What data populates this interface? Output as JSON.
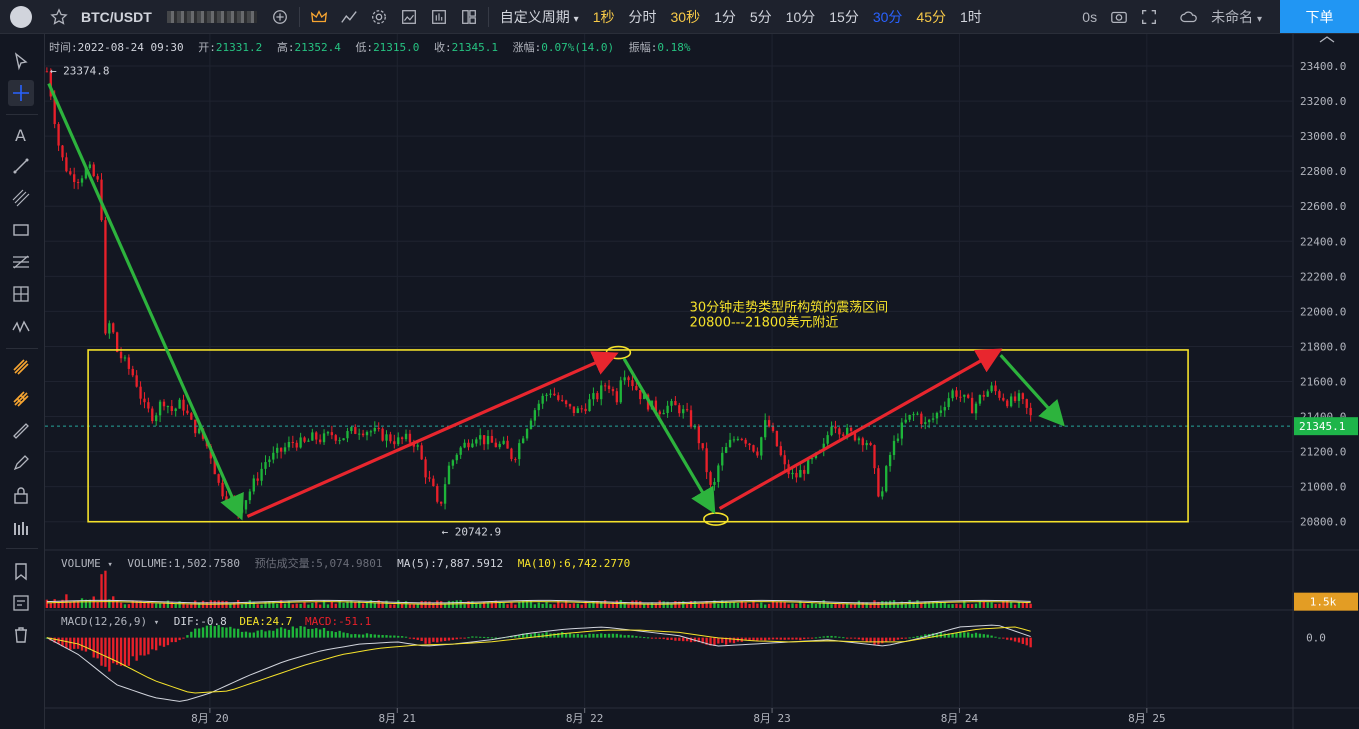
{
  "toolbar": {
    "symbol": "BTC/USDT",
    "custom_period_label": "自定义周期",
    "timeframes": [
      {
        "label": "1秒",
        "state": "fav"
      },
      {
        "label": "分时",
        "state": ""
      },
      {
        "label": "30秒",
        "state": "fav"
      },
      {
        "label": "1分",
        "state": ""
      },
      {
        "label": "5分",
        "state": ""
      },
      {
        "label": "10分",
        "state": ""
      },
      {
        "label": "15分",
        "state": ""
      },
      {
        "label": "30分",
        "state": "active"
      },
      {
        "label": "45分",
        "state": "fav"
      },
      {
        "label": "1时",
        "state": ""
      }
    ],
    "replay_label": "0s",
    "layout_name": "未命名",
    "order_button": "下单"
  },
  "header": {
    "time_label": "时间:",
    "time": "2022-08-24 09:30",
    "open_label": "开:",
    "open": "21331.2",
    "high_label": "高:",
    "high": "21352.4",
    "low_label": "低:",
    "low": "21315.0",
    "close_label": "收:",
    "close": "21345.1",
    "change_label": "涨幅:",
    "change": "0.07%(14.0)",
    "amplitude_label": "振幅:",
    "amplitude": "0.18%"
  },
  "volume_legend": {
    "name": "VOLUME",
    "volume": "VOLUME:1,502.7580",
    "estimated": "预估成交量:5,074.9801",
    "ma5": "MA(5):7,887.5912",
    "ma10": "MA(10):6,742.2770"
  },
  "macd_legend": {
    "name": "MACD(12,26,9)",
    "dif": "DIF:-0.8",
    "dea": "DEA:24.7",
    "macd": "MACD:-51.1"
  },
  "colors": {
    "background": "#131722",
    "up": "#26a69a",
    "up_bright": "#1eb53a",
    "down": "#e8202a",
    "box": "#f5e22b",
    "annotation": "#f5e22b",
    "arrow_green": "#2db33d",
    "arrow_red": "#e8262e",
    "price_badge": "#1eb54a",
    "vol_badge": "#e39d24"
  },
  "chart_data": {
    "type": "candlestick",
    "symbol": "BTC/USDT",
    "interval": "30分",
    "ylim": [
      20650,
      23480
    ],
    "yticks": [
      23400,
      23200,
      23000,
      22800,
      22600,
      22400,
      22200,
      22000,
      21800,
      21600,
      21400,
      21200,
      21000,
      20800
    ],
    "ytick_labels": [
      "23400.0",
      "23200.0",
      "23000.0",
      "22800.0",
      "22600.0",
      "22400.0",
      "22200.0",
      "22000.0",
      "21800.0",
      "21600.0",
      "21400.0",
      "21200.0",
      "21000.0",
      "20800.0"
    ],
    "xticks": [
      "8月 20",
      "8月 21",
      "8月 22",
      "8月 23",
      "8月 24",
      "8月 25"
    ],
    "x_range_days": [
      19.12,
      25.78
    ],
    "xtick_days": [
      20,
      21,
      22,
      23,
      24,
      25
    ],
    "last_price": 21345.1,
    "last_price_label": "21345.1",
    "high_marker": {
      "day": 19.13,
      "price": 23374.8,
      "label": "23374.8"
    },
    "low_marker": {
      "day": 21.22,
      "price": 20742.9,
      "label": "20742.9"
    },
    "range_box": {
      "day_start": 19.35,
      "day_end": 25.22,
      "price_low": 20800,
      "price_high": 21780
    },
    "annotation": [
      "30分钟走势类型所构筑的震荡区间",
      "20800---21800美元附近"
    ],
    "annotation_anchor": {
      "day": 22.56,
      "price": 22000
    },
    "circles": [
      {
        "day": 22.18,
        "price": 21765
      },
      {
        "day": 22.7,
        "price": 20815
      }
    ],
    "arrows": [
      {
        "from": [
          19.14,
          23300
        ],
        "to": [
          20.16,
          20840
        ],
        "color": "green"
      },
      {
        "from": [
          20.2,
          20830
        ],
        "to": [
          22.15,
          21750
        ],
        "color": "red"
      },
      {
        "from": [
          22.21,
          21730
        ],
        "to": [
          22.68,
          20875
        ],
        "color": "green"
      },
      {
        "from": [
          22.72,
          20875
        ],
        "to": [
          24.2,
          21770
        ],
        "color": "red"
      },
      {
        "from": [
          24.22,
          21750
        ],
        "to": [
          24.54,
          21370
        ],
        "color": "green"
      }
    ],
    "price_path": [
      [
        19.13,
        23370
      ],
      [
        19.15,
        23250
      ],
      [
        19.2,
        22900
      ],
      [
        19.25,
        22780
      ],
      [
        19.3,
        22760
      ],
      [
        19.35,
        22820
      ],
      [
        19.42,
        22700
      ],
      [
        19.43,
        21800
      ],
      [
        19.47,
        21950
      ],
      [
        19.5,
        21780
      ],
      [
        19.55,
        21700
      ],
      [
        19.6,
        21620
      ],
      [
        19.65,
        21450
      ],
      [
        19.7,
        21400
      ],
      [
        19.75,
        21500
      ],
      [
        19.8,
        21430
      ],
      [
        19.85,
        21480
      ],
      [
        19.9,
        21360
      ],
      [
        19.95,
        21300
      ],
      [
        20.0,
        21200
      ],
      [
        20.05,
        21000
      ],
      [
        20.1,
        20920
      ],
      [
        20.15,
        20860
      ],
      [
        20.2,
        20950
      ],
      [
        20.25,
        21050
      ],
      [
        20.3,
        21150
      ],
      [
        20.35,
        21180
      ],
      [
        20.4,
        21220
      ],
      [
        20.45,
        21260
      ],
      [
        20.5,
        21240
      ],
      [
        20.55,
        21280
      ],
      [
        20.6,
        21270
      ],
      [
        20.65,
        21300
      ],
      [
        20.7,
        21280
      ],
      [
        20.75,
        21310
      ],
      [
        20.8,
        21330
      ],
      [
        20.85,
        21320
      ],
      [
        20.9,
        21300
      ],
      [
        20.95,
        21280
      ],
      [
        21.0,
        21260
      ],
      [
        21.05,
        21270
      ],
      [
        21.1,
        21250
      ],
      [
        21.15,
        21080
      ],
      [
        21.2,
        20960
      ],
      [
        21.22,
        20850
      ],
      [
        21.27,
        21100
      ],
      [
        21.32,
        21200
      ],
      [
        21.37,
        21250
      ],
      [
        21.42,
        21300
      ],
      [
        21.47,
        21260
      ],
      [
        21.52,
        21240
      ],
      [
        21.57,
        21230
      ],
      [
        21.62,
        21160
      ],
      [
        21.67,
        21300
      ],
      [
        21.72,
        21420
      ],
      [
        21.77,
        21500
      ],
      [
        21.82,
        21550
      ],
      [
        21.87,
        21480
      ],
      [
        21.92,
        21440
      ],
      [
        21.97,
        21430
      ],
      [
        22.02,
        21480
      ],
      [
        22.07,
        21520
      ],
      [
        22.12,
        21600
      ],
      [
        22.17,
        21500
      ],
      [
        22.2,
        21680
      ],
      [
        22.25,
        21600
      ],
      [
        22.3,
        21520
      ],
      [
        22.35,
        21460
      ],
      [
        22.4,
        21440
      ],
      [
        22.45,
        21460
      ],
      [
        22.5,
        21450
      ],
      [
        22.55,
        21400
      ],
      [
        22.6,
        21300
      ],
      [
        22.64,
        21150
      ],
      [
        22.68,
        20950
      ],
      [
        22.72,
        21150
      ],
      [
        22.77,
        21240
      ],
      [
        22.82,
        21300
      ],
      [
        22.87,
        21260
      ],
      [
        22.92,
        21200
      ],
      [
        22.97,
        21380
      ],
      [
        23.02,
        21250
      ],
      [
        23.07,
        21100
      ],
      [
        23.12,
        21050
      ],
      [
        23.17,
        21100
      ],
      [
        23.22,
        21150
      ],
      [
        23.27,
        21200
      ],
      [
        23.32,
        21380
      ],
      [
        23.37,
        21320
      ],
      [
        23.42,
        21300
      ],
      [
        23.47,
        21280
      ],
      [
        23.52,
        21250
      ],
      [
        23.55,
        21050
      ],
      [
        23.58,
        20920
      ],
      [
        23.62,
        21150
      ],
      [
        23.67,
        21300
      ],
      [
        23.72,
        21380
      ],
      [
        23.77,
        21420
      ],
      [
        23.82,
        21350
      ],
      [
        23.87,
        21400
      ],
      [
        23.92,
        21480
      ],
      [
        23.97,
        21550
      ],
      [
        24.02,
        21500
      ],
      [
        24.07,
        21450
      ],
      [
        24.12,
        21520
      ],
      [
        24.17,
        21560
      ],
      [
        24.22,
        21520
      ],
      [
        24.27,
        21480
      ],
      [
        24.32,
        21500
      ],
      [
        24.37,
        21420
      ],
      [
        24.4,
        21345
      ]
    ],
    "volume": {
      "ylim": [
        0,
        9000
      ],
      "ytick_label": "1.5k",
      "spike": {
        "day": 19.43,
        "value": 7800
      }
    },
    "macd": {
      "ylim": [
        -320,
        120
      ],
      "ytick_label": "0.0",
      "tick_value": 0,
      "hist_path": [
        [
          19.13,
          0
        ],
        [
          19.2,
          -40
        ],
        [
          19.35,
          -60
        ],
        [
          19.45,
          -140
        ],
        [
          19.55,
          -120
        ],
        [
          19.65,
          -80
        ],
        [
          19.75,
          -40
        ],
        [
          19.85,
          -10
        ],
        [
          19.9,
          30
        ],
        [
          20.0,
          55
        ],
        [
          20.1,
          45
        ],
        [
          20.2,
          25
        ],
        [
          20.35,
          40
        ],
        [
          20.5,
          50
        ],
        [
          20.6,
          40
        ],
        [
          20.75,
          20
        ],
        [
          20.9,
          15
        ],
        [
          21.05,
          5
        ],
        [
          21.15,
          -25
        ],
        [
          21.25,
          -20
        ],
        [
          21.4,
          5
        ],
        [
          21.55,
          0
        ],
        [
          21.7,
          20
        ],
        [
          21.85,
          25
        ],
        [
          22.0,
          15
        ],
        [
          22.15,
          20
        ],
        [
          22.3,
          5
        ],
        [
          22.45,
          -10
        ],
        [
          22.6,
          -25
        ],
        [
          22.7,
          -35
        ],
        [
          22.85,
          -15
        ],
        [
          23.0,
          -10
        ],
        [
          23.15,
          -10
        ],
        [
          23.3,
          10
        ],
        [
          23.45,
          -5
        ],
        [
          23.55,
          -30
        ],
        [
          23.7,
          -5
        ],
        [
          23.85,
          20
        ],
        [
          24.0,
          25
        ],
        [
          24.15,
          15
        ],
        [
          24.3,
          -20
        ],
        [
          24.4,
          -50
        ]
      ],
      "dif_path": [
        [
          19.13,
          0
        ],
        [
          19.3,
          -80
        ],
        [
          19.5,
          -220
        ],
        [
          19.7,
          -280
        ],
        [
          19.85,
          -300
        ],
        [
          20.0,
          -260
        ],
        [
          20.2,
          -180
        ],
        [
          20.4,
          -110
        ],
        [
          20.6,
          -60
        ],
        [
          20.8,
          -30
        ],
        [
          21.0,
          -20
        ],
        [
          21.15,
          -40
        ],
        [
          21.3,
          -30
        ],
        [
          21.5,
          -10
        ],
        [
          21.7,
          20
        ],
        [
          21.9,
          40
        ],
        [
          22.1,
          50
        ],
        [
          22.3,
          30
        ],
        [
          22.5,
          10
        ],
        [
          22.7,
          -40
        ],
        [
          22.9,
          -30
        ],
        [
          23.1,
          -20
        ],
        [
          23.3,
          -10
        ],
        [
          23.5,
          -30
        ],
        [
          23.6,
          -40
        ],
        [
          23.8,
          0
        ],
        [
          24.0,
          50
        ],
        [
          24.2,
          60
        ],
        [
          24.4,
          -1
        ]
      ],
      "dea_path": [
        [
          19.13,
          0
        ],
        [
          19.3,
          -30
        ],
        [
          19.5,
          -110
        ],
        [
          19.7,
          -200
        ],
        [
          19.9,
          -260
        ],
        [
          20.1,
          -250
        ],
        [
          20.3,
          -190
        ],
        [
          20.5,
          -130
        ],
        [
          20.7,
          -80
        ],
        [
          20.9,
          -50
        ],
        [
          21.1,
          -35
        ],
        [
          21.3,
          -30
        ],
        [
          21.5,
          -20
        ],
        [
          21.7,
          0
        ],
        [
          21.9,
          20
        ],
        [
          22.1,
          35
        ],
        [
          22.3,
          35
        ],
        [
          22.5,
          25
        ],
        [
          22.7,
          0
        ],
        [
          22.9,
          -15
        ],
        [
          23.1,
          -20
        ],
        [
          23.3,
          -15
        ],
        [
          23.5,
          -20
        ],
        [
          23.7,
          -20
        ],
        [
          23.9,
          10
        ],
        [
          24.1,
          40
        ],
        [
          24.3,
          50
        ],
        [
          24.4,
          25
        ]
      ]
    }
  }
}
